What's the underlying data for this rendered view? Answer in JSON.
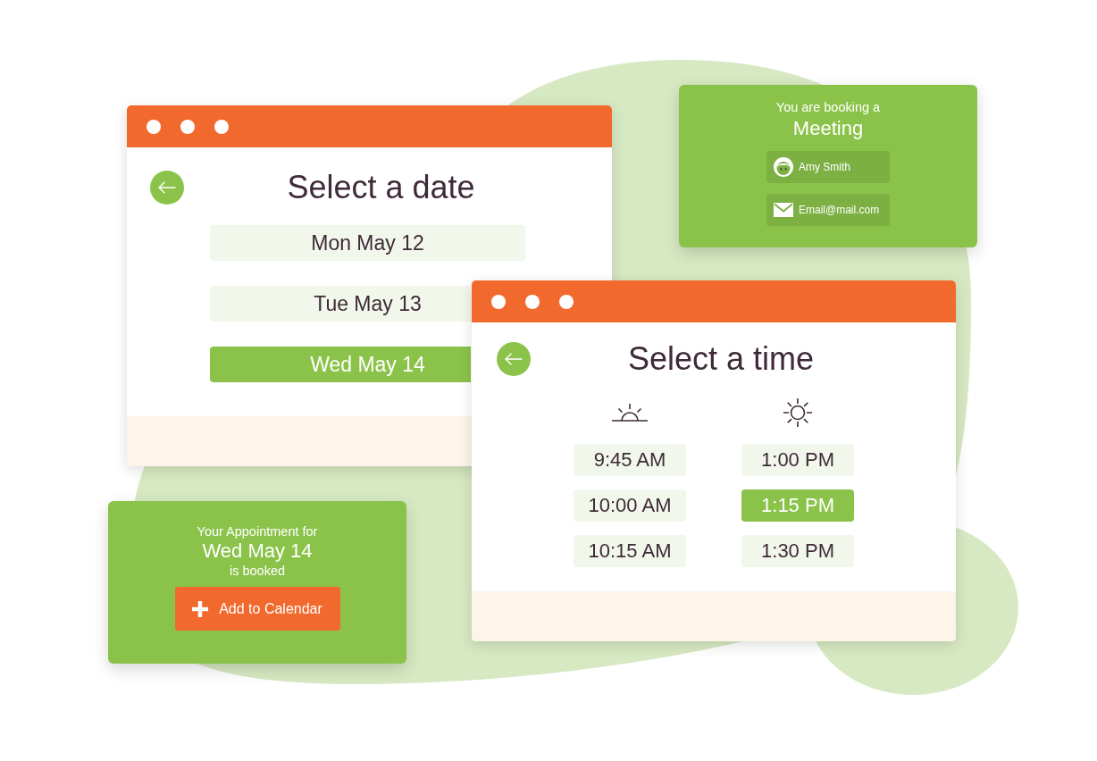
{
  "date_window": {
    "title": "Select a date",
    "dates": [
      {
        "label": "Mon May 12",
        "selected": false
      },
      {
        "label": "Tue May 13",
        "selected": false
      },
      {
        "label": "Wed May 14",
        "selected": true
      }
    ]
  },
  "booking_card": {
    "intro": "You are booking a",
    "type": "Meeting",
    "fields": [
      {
        "kind": "name",
        "value": "Amy Smith"
      },
      {
        "kind": "email",
        "value": "Email@mail.com"
      }
    ]
  },
  "time_window": {
    "title": "Select a time",
    "columns": [
      {
        "kind": "morning",
        "slots": [
          {
            "label": "9:45 AM",
            "selected": false
          },
          {
            "label": "10:00 AM",
            "selected": false
          },
          {
            "label": "10:15 AM",
            "selected": false
          }
        ]
      },
      {
        "kind": "afternoon",
        "slots": [
          {
            "label": "1:00 PM",
            "selected": false
          },
          {
            "label": "1:15 PM",
            "selected": true
          },
          {
            "label": "1:30 PM",
            "selected": false
          }
        ]
      }
    ]
  },
  "confirmation_card": {
    "intro": "Your Appointment for",
    "date": "Wed May 14",
    "status": "is booked",
    "button": "Add to Calendar"
  }
}
